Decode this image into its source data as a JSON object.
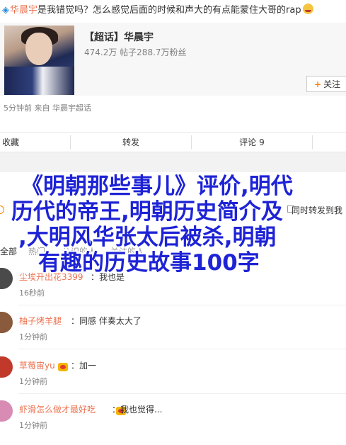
{
  "post": {
    "mention": "华晨宇",
    "text": "是我错觉吗？怎么感觉后面的时候和声大的有点能蒙住大哥的rap"
  },
  "topic_card": {
    "title": "【超话】华晨宇",
    "stats": "474.2万 帖子288.7万粉丝",
    "follow_label": "关注"
  },
  "meta": "5分钟前  来自 华晨宇超话",
  "actions": [
    "收藏",
    "转发",
    "评论 9",
    ""
  ],
  "comment_box": {
    "forward_label": "同时转发到我"
  },
  "tabs": [
    "全部",
    "热门",
    "认识的人",
    "关注的人"
  ],
  "comments": [
    {
      "name": "尘埃开出花3399",
      "text": "：我也是",
      "time": "16秒前",
      "avatar_color": "#4a4a4a"
    },
    {
      "name": "柚子烤羊腿",
      "text": "：同感 伴奏太大了",
      "time": "1分钟前",
      "avatar_color": "#8a5a3c"
    },
    {
      "name": "草莓宙yu",
      "text": "：加一",
      "time": "1分钟前",
      "avatar_color": "#c0392b"
    },
    {
      "name": "虾滑怎么做才最好吃",
      "text": "：我也觉得...",
      "time": "1分钟前",
      "avatar_color": "#d98cb3"
    }
  ],
  "overlay_lines": [
    "《明朝那些事儿》评价,明代",
    "历代的帝王,明朝历史简介及",
    ",大明风华张太后被杀,明朝",
    "有趣的历史故事100字"
  ],
  "colors": {
    "accent": "#eb7350",
    "overlay_text": "#1e23d6",
    "follow_plus": "#ff8200"
  }
}
